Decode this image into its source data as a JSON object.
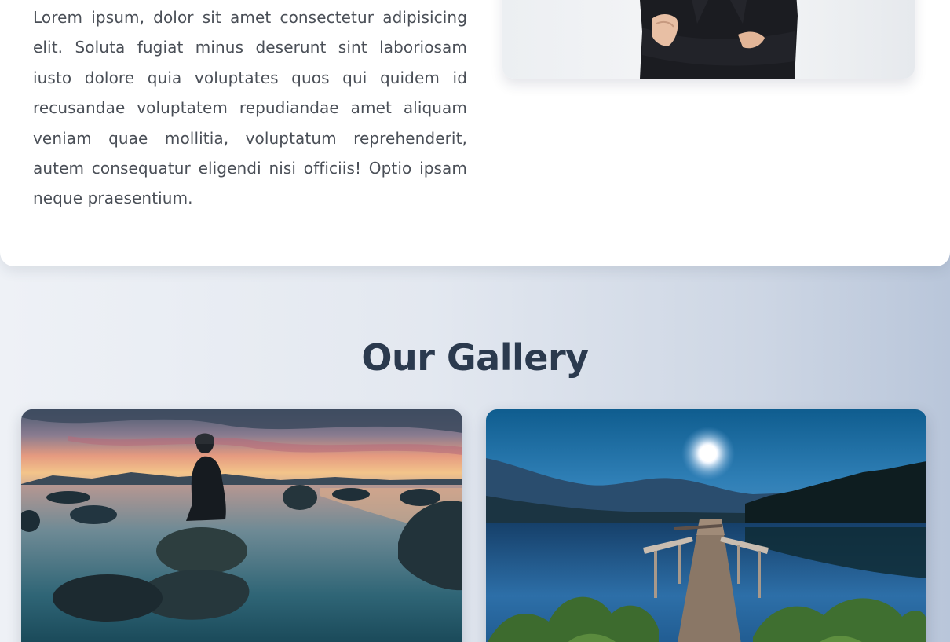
{
  "about": {
    "paragraph": "Lorem ipsum, dolor sit amet consectetur adipisicing elit. Soluta fugiat minus deserunt sint laboriosam iusto dolore quia voluptates quos qui quidem id recusandae voluptatem repudiandae amet aliquam veniam quae mollitia, voluptatum reprehenderit, autem consequatur eligendi nisi officiis! Optio ipsam neque praesentium."
  },
  "gallery": {
    "title": "Our Gallery"
  },
  "colors": {
    "heading": "#2b3a4e",
    "body_text": "#4a4f57",
    "card_background": "#ffffff"
  }
}
